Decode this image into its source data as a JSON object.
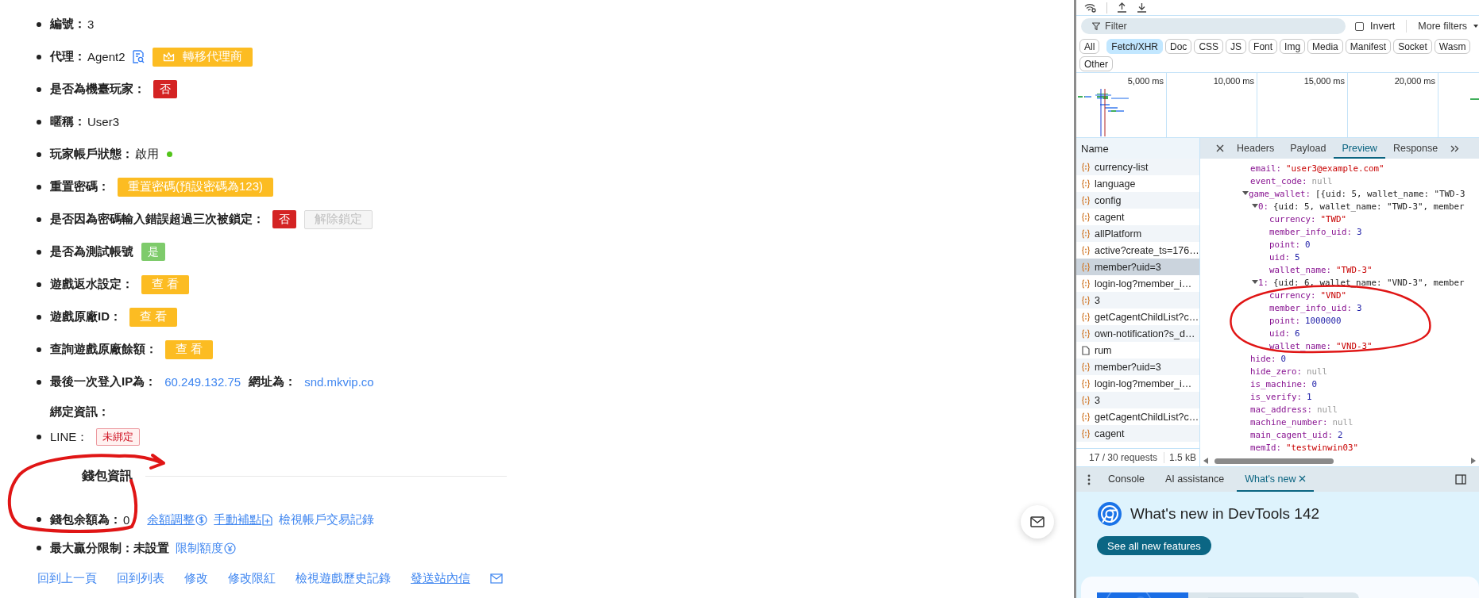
{
  "detail": {
    "fields": [
      {
        "parts": [
          {
            "kind": "label",
            "text": "編號："
          },
          {
            "kind": "value",
            "text": "3"
          }
        ]
      },
      {
        "parts": [
          {
            "kind": "label",
            "text": "代理："
          },
          {
            "kind": "value",
            "text": "Agent2"
          },
          {
            "kind": "button",
            "text": "轉移代理商",
            "disabled": false
          }
        ]
      },
      {
        "parts": [
          {
            "kind": "label",
            "text": "是否為機臺玩家："
          },
          {
            "kind": "tag",
            "text": "否",
            "color": "#d42323"
          }
        ]
      },
      {
        "parts": [
          {
            "kind": "label",
            "text": "暱稱："
          },
          {
            "kind": "value",
            "text": "User3"
          }
        ]
      },
      {
        "parts": [
          {
            "kind": "label",
            "text": "玩家帳戶狀態："
          },
          {
            "kind": "value",
            "text": "啟用"
          },
          {
            "kind": "dot",
            "color": "#52c41a"
          }
        ]
      },
      {
        "parts": [
          {
            "kind": "label",
            "text": "重置密碼："
          },
          {
            "kind": "button",
            "text": "重置密碼(預設密碼為123)",
            "disabled": false
          }
        ]
      },
      {
        "parts": [
          {
            "kind": "label",
            "text": "是否因為密碼輸入錯誤超過三次被鎖定："
          },
          {
            "kind": "tag",
            "text": "否",
            "color": "#d42323"
          },
          {
            "kind": "button",
            "text": "解除鎖定",
            "disabled": true
          }
        ]
      },
      {
        "parts": [
          {
            "kind": "label",
            "text": "是否為測試帳號"
          },
          {
            "kind": "tag",
            "text": "是",
            "color": "#7ecb6b"
          }
        ]
      },
      {
        "parts": [
          {
            "kind": "label",
            "text": "遊戲返水設定："
          },
          {
            "kind": "button",
            "text": "查 看",
            "disabled": false
          }
        ]
      },
      {
        "parts": [
          {
            "kind": "label",
            "text": "遊戲原廠ID："
          },
          {
            "kind": "button",
            "text": "查 看",
            "disabled": false
          }
        ]
      },
      {
        "parts": [
          {
            "kind": "label",
            "text": "查詢遊戲原廠餘額："
          },
          {
            "kind": "button",
            "text": "查 看",
            "disabled": false
          }
        ]
      },
      {
        "parts": [
          {
            "kind": "label",
            "text": "最後一次登入IP為："
          },
          {
            "kind": "link",
            "text": "60.249.132.75",
            "underlined": false
          },
          {
            "kind": "label",
            "text": "網址為："
          },
          {
            "kind": "link",
            "text": "snd.mkvip.co",
            "underlined": false
          }
        ]
      }
    ],
    "binding": {
      "heading": "綁定資訊：",
      "items": [
        {
          "parts": [
            {
              "kind": "value",
              "text": "LINE："
            },
            {
              "kind": "outline-tag",
              "text": "未綁定",
              "color": "#cf1322"
            }
          ]
        }
      ]
    },
    "wallet": {
      "title": "錢包資訊",
      "fields": [
        {
          "parts": [
            {
              "kind": "label",
              "text": "錢包余額為："
            },
            {
              "kind": "value",
              "text": "0"
            },
            {
              "kind": "link",
              "text": "余額調整",
              "underlined": true
            },
            {
              "kind": "link",
              "text": "手動補點",
              "underlined": true
            },
            {
              "kind": "link",
              "text": "檢視帳戶交易記錄",
              "underlined": false
            }
          ]
        },
        {
          "parts": [
            {
              "kind": "label",
              "text": "最大贏分限制：未設置"
            },
            {
              "kind": "link",
              "text": "限制額度",
              "underlined": false
            }
          ]
        }
      ]
    },
    "footer_links": [
      {
        "text": "回到上一頁",
        "underlined": false
      },
      {
        "text": "回到列表",
        "underlined": false
      },
      {
        "text": "修改",
        "underlined": false
      },
      {
        "text": "修改限紅",
        "underlined": false
      },
      {
        "text": "檢視遊戲歷史記錄",
        "underlined": false
      },
      {
        "text": "發送站內信",
        "underlined": true
      }
    ]
  },
  "devtools": {
    "filter": {
      "placeholder": "Filter"
    },
    "invert": {
      "label": "Invert",
      "checked": false
    },
    "more_filters": "More filters",
    "type_filters": [
      {
        "label": "All",
        "selected": false
      },
      {
        "label": "Fetch/XHR",
        "selected": true
      },
      {
        "label": "Doc",
        "selected": false
      },
      {
        "label": "CSS",
        "selected": false
      },
      {
        "label": "JS",
        "selected": false
      },
      {
        "label": "Font",
        "selected": false
      },
      {
        "label": "Img",
        "selected": false
      },
      {
        "label": "Media",
        "selected": false
      },
      {
        "label": "Manifest",
        "selected": false
      },
      {
        "label": "Socket",
        "selected": false
      },
      {
        "label": "Wasm",
        "selected": false
      },
      {
        "label": "Other",
        "selected": false
      }
    ],
    "timeline_ticks": [
      "5,000 ms",
      "10,000 ms",
      "15,000 ms",
      "20,000 ms"
    ],
    "requests": {
      "header": "Name",
      "rows": [
        {
          "name": "currency-list",
          "kind": "fetch",
          "selected": false
        },
        {
          "name": "language",
          "kind": "fetch",
          "selected": false
        },
        {
          "name": "config",
          "kind": "fetch",
          "selected": false
        },
        {
          "name": "cagent",
          "kind": "fetch",
          "selected": false
        },
        {
          "name": "allPlatform",
          "kind": "fetch",
          "selected": false
        },
        {
          "name": "active?create_ts=176…",
          "kind": "fetch",
          "selected": false
        },
        {
          "name": "member?uid=3",
          "kind": "fetch",
          "selected": true
        },
        {
          "name": "login-log?member_i…",
          "kind": "fetch",
          "selected": false
        },
        {
          "name": "3",
          "kind": "fetch",
          "selected": false
        },
        {
          "name": "getCagentChildList?c…",
          "kind": "fetch",
          "selected": false
        },
        {
          "name": "own-notification?s_d…",
          "kind": "fetch",
          "selected": false
        },
        {
          "name": "rum",
          "kind": "doc",
          "selected": false
        },
        {
          "name": "member?uid=3",
          "kind": "fetch",
          "selected": false
        },
        {
          "name": "login-log?member_i…",
          "kind": "fetch",
          "selected": false
        },
        {
          "name": "3",
          "kind": "fetch",
          "selected": false
        },
        {
          "name": "getCagentChildList?c…",
          "kind": "fetch",
          "selected": false
        },
        {
          "name": "cagent",
          "kind": "fetch",
          "selected": false
        }
      ]
    },
    "summary": {
      "requests": "17 / 30 requests",
      "size": "1.5 kB"
    },
    "detail_tabs": [
      {
        "label": "Headers",
        "selected": false
      },
      {
        "label": "Payload",
        "selected": false
      },
      {
        "label": "Preview",
        "selected": true
      },
      {
        "label": "Response",
        "selected": false
      }
    ],
    "preview": [
      {
        "key": "email:",
        "value": "\"user3@example.com\"",
        "kind": "string"
      },
      {
        "key": "event_code:",
        "value": "null",
        "kind": "null"
      },
      {
        "key": "game_wallet:",
        "value": "[{uid: 5, wallet_name: \"TWD-3",
        "kind": "summary",
        "expanded": true,
        "children": [
          {
            "key": "0:",
            "value": "{uid: 5, wallet_name: \"TWD-3\", member",
            "kind": "summary",
            "expanded": true,
            "children": [
              {
                "key": "currency:",
                "value": "\"TWD\"",
                "kind": "string"
              },
              {
                "key": "member_info_uid:",
                "value": "3",
                "kind": "number"
              },
              {
                "key": "point:",
                "value": "0",
                "kind": "number"
              },
              {
                "key": "uid:",
                "value": "5",
                "kind": "number"
              },
              {
                "key": "wallet_name:",
                "value": "\"TWD-3\"",
                "kind": "string"
              }
            ]
          },
          {
            "key": "1:",
            "value": "{uid: 6, wallet_name: \"VND-3\", member",
            "kind": "summary",
            "expanded": true,
            "children": [
              {
                "key": "currency:",
                "value": "\"VND\"",
                "kind": "string"
              },
              {
                "key": "member_info_uid:",
                "value": "3",
                "kind": "number"
              },
              {
                "key": "point:",
                "value": "1000000",
                "kind": "number"
              },
              {
                "key": "uid:",
                "value": "6",
                "kind": "number"
              },
              {
                "key": "wallet_name:",
                "value": "\"VND-3\"",
                "kind": "string"
              }
            ]
          }
        ]
      },
      {
        "key": "hide:",
        "value": "0",
        "kind": "number"
      },
      {
        "key": "hide_zero:",
        "value": "null",
        "kind": "null"
      },
      {
        "key": "is_machine:",
        "value": "0",
        "kind": "number"
      },
      {
        "key": "is_verify:",
        "value": "1",
        "kind": "number"
      },
      {
        "key": "mac_address:",
        "value": "null",
        "kind": "null"
      },
      {
        "key": "machine_number:",
        "value": "null",
        "kind": "null"
      },
      {
        "key": "main_cagent_uid:",
        "value": "2",
        "kind": "number"
      },
      {
        "key": "memId:",
        "value": "\"testwinwin03\"",
        "kind": "string"
      }
    ],
    "drawer_tabs": [
      {
        "label": "Console",
        "selected": false
      },
      {
        "label": "AI assistance",
        "selected": false
      },
      {
        "label": "What's new",
        "selected": true
      }
    ],
    "whats_new": {
      "title": "What's new in DevTools 142",
      "button": "See all new features"
    }
  }
}
